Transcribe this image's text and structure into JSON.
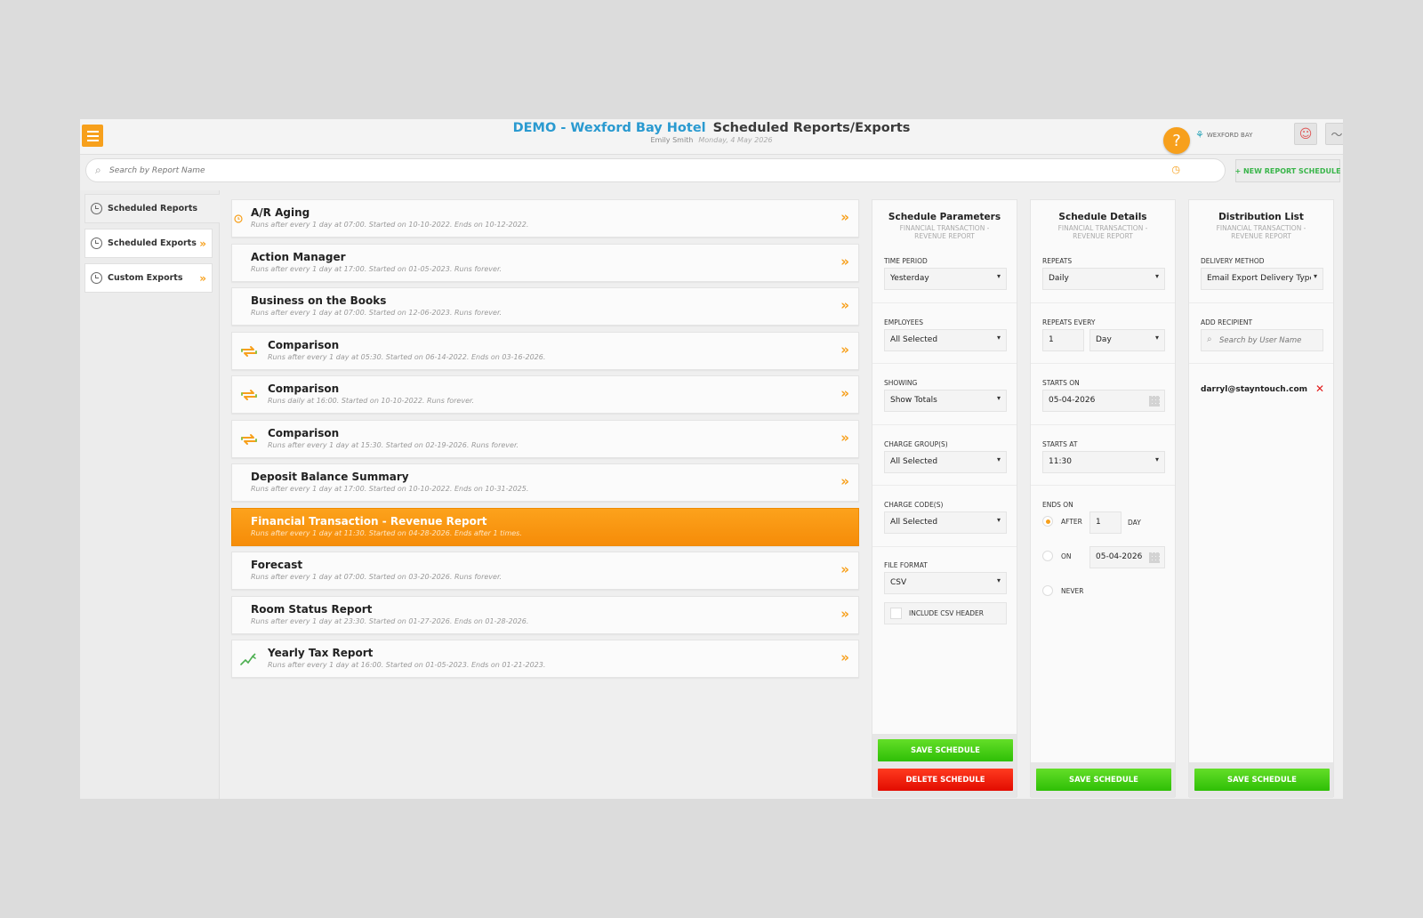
{
  "header": {
    "hotel": "DEMO - Wexford Bay Hotel",
    "title": "Scheduled Reports/Exports",
    "user": "Emily Smith",
    "date": "Monday, 4 May 2026",
    "help_glyph": "?",
    "property_logo": "WEXFORD BAY"
  },
  "search": {
    "placeholder": "Search by Report Name"
  },
  "toolbar": {
    "new_schedule": "+ NEW REPORT SCHEDULE"
  },
  "sidebar": {
    "items": [
      {
        "label": "Scheduled Reports",
        "icon": "clock-icon",
        "active": true
      },
      {
        "label": "Scheduled Exports",
        "icon": "clock-icon",
        "chevron": "»"
      },
      {
        "label": "Custom Exports",
        "icon": "clock-icon",
        "chevron": "»"
      }
    ]
  },
  "reports": [
    {
      "name": "A/R Aging",
      "desc": "Runs after every 1 day at 07:00. Started on 10-10-2022. Ends on 10-12-2022.",
      "icon": "clock-icon",
      "chevron": "»"
    },
    {
      "name": "Action Manager",
      "desc": "Runs after every 1 day at 17:00. Started on 01-05-2023. Runs forever.",
      "icon": "",
      "chevron": "»"
    },
    {
      "name": "Business on the Books",
      "desc": "Runs after every 1 day at 07:00. Started on 12-06-2023. Runs forever.",
      "icon": "",
      "chevron": "»"
    },
    {
      "name": "Comparison",
      "desc": "Runs after every 1 day at 05:30. Started on 06-14-2022. Ends on 03-16-2026.",
      "icon": "compare-icon",
      "chevron": "»"
    },
    {
      "name": "Comparison",
      "desc": "Runs daily at 16:00. Started on 10-10-2022. Runs forever.",
      "icon": "compare-icon",
      "chevron": "»"
    },
    {
      "name": "Comparison",
      "desc": "Runs after every 1 day at 15:30. Started on 02-19-2026. Runs forever.",
      "icon": "compare-icon",
      "chevron": "»"
    },
    {
      "name": "Deposit Balance Summary",
      "desc": "Runs after every 1 day at 17:00. Started on 10-10-2022. Ends on 10-31-2025.",
      "icon": "",
      "chevron": "»"
    },
    {
      "name": "Financial Transaction - Revenue Report",
      "desc": "Runs after every 1 day at 11:30. Started on 04-28-2026. Ends after 1 times.",
      "icon": "",
      "selected": true
    },
    {
      "name": "Forecast",
      "desc": "Runs after every 1 day at 07:00. Started on 03-20-2026. Runs forever.",
      "icon": "",
      "chevron": "»"
    },
    {
      "name": "Room Status Report",
      "desc": "Runs after every 1 day at 23:30. Started on 01-27-2026. Ends on 01-28-2026.",
      "icon": "",
      "chevron": "»"
    },
    {
      "name": "Yearly Tax Report",
      "desc": "Runs after every 1 day at 16:00. Started on 01-05-2023. Ends on 01-21-2023.",
      "icon": "trend-icon",
      "chevron": "»"
    }
  ],
  "params": {
    "title": "Schedule Parameters",
    "subtitle": "FINANCIAL TRANSACTION - REVENUE REPORT",
    "time_period_label": "TIME PERIOD",
    "time_period": "Yesterday",
    "employees_label": "EMPLOYEES",
    "employees": "All Selected",
    "showing_label": "SHOWING",
    "showing": "Show Totals",
    "charge_groups_label": "CHARGE GROUP(S)",
    "charge_groups": "All Selected",
    "charge_codes_label": "CHARGE CODE(S)",
    "charge_codes": "All Selected",
    "file_format_label": "FILE FORMAT",
    "file_format": "CSV",
    "csv_header_label": "INCLUDE CSV HEADER",
    "save": "SAVE SCHEDULE",
    "delete": "DELETE SCHEDULE"
  },
  "details": {
    "title": "Schedule Details",
    "subtitle": "FINANCIAL TRANSACTION - REVENUE REPORT",
    "repeats_label": "REPEATS",
    "repeats": "Daily",
    "repeats_every_label": "REPEATS EVERY",
    "repeats_every_value": "1",
    "repeats_every_unit": "Day",
    "starts_on_label": "STARTS ON",
    "starts_on": "05-04-2026",
    "starts_at_label": "STARTS AT",
    "starts_at": "11:30",
    "ends_on_label": "ENDS ON",
    "after_label": "AFTER",
    "after_value": "1",
    "after_unit": "DAY",
    "on_label": "ON",
    "on_value": "05-04-2026",
    "never_label": "NEVER",
    "ends_selected": "after",
    "save": "SAVE SCHEDULE"
  },
  "distribution": {
    "title": "Distribution List",
    "subtitle": "FINANCIAL TRANSACTION - REVENUE REPORT",
    "delivery_label": "DELIVERY METHOD",
    "delivery": "Email Export Delivery Type",
    "add_recipient_label": "ADD RECIPIENT",
    "recipient_placeholder": "Search by User Name",
    "recipients": [
      "darryl@stayntouch.com"
    ],
    "remove_glyph": "✕",
    "save": "SAVE SCHEDULE"
  },
  "colors": {
    "accent": "#f7a01c",
    "hotel_blue": "#2a9ad0",
    "save_green": "#39b54a",
    "delete_red": "#e20c00"
  }
}
